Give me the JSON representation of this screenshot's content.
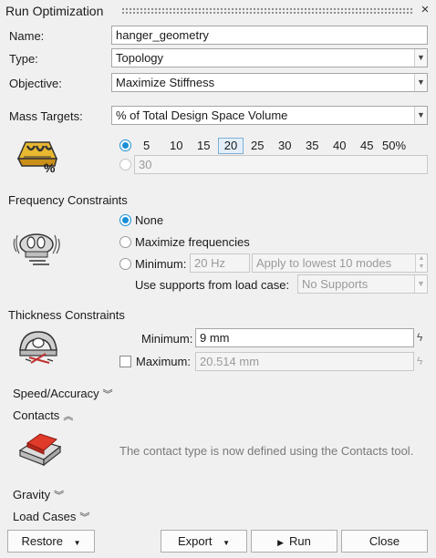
{
  "window": {
    "title": "Run Optimization",
    "close_glyph": "×"
  },
  "form": {
    "name_label": "Name:",
    "name_value": "hanger_geometry",
    "type_label": "Type:",
    "type_value": "Topology",
    "objective_label": "Objective:",
    "objective_value": "Maximize Stiffness",
    "mass_label": "Mass Targets:",
    "mass_value": "% of Total Design Space Volume"
  },
  "mass_targets": {
    "percentages": [
      "5",
      "10",
      "15",
      "20",
      "25",
      "30",
      "35",
      "40",
      "45",
      "50%"
    ],
    "selected": "20",
    "custom_value": "30",
    "icon_percent": "%"
  },
  "frequency": {
    "heading": "Frequency Constraints",
    "none_label": "None",
    "maximize_label": "Maximize frequencies",
    "minimum_label": "Minimum:",
    "minimum_value": "20 Hz",
    "modes_value": "Apply to lowest 10 modes",
    "supports_label": "Use supports from load case:",
    "supports_value": "No Supports"
  },
  "thickness": {
    "heading": "Thickness Constraints",
    "minimum_label": "Minimum:",
    "minimum_value": "9 mm",
    "maximum_label": "Maximum:",
    "maximum_value": "20.514 mm"
  },
  "sections": {
    "speed": "Speed/Accuracy",
    "contacts": "Contacts",
    "contacts_note": "The contact type is now defined using the Contacts tool.",
    "gravity": "Gravity",
    "load_cases": "Load Cases"
  },
  "footer": {
    "restore": "Restore",
    "export": "Export",
    "run": "Run",
    "close": "Close"
  },
  "colors": {
    "accent": "#1a8fd6",
    "background": "#f0f0f0"
  }
}
